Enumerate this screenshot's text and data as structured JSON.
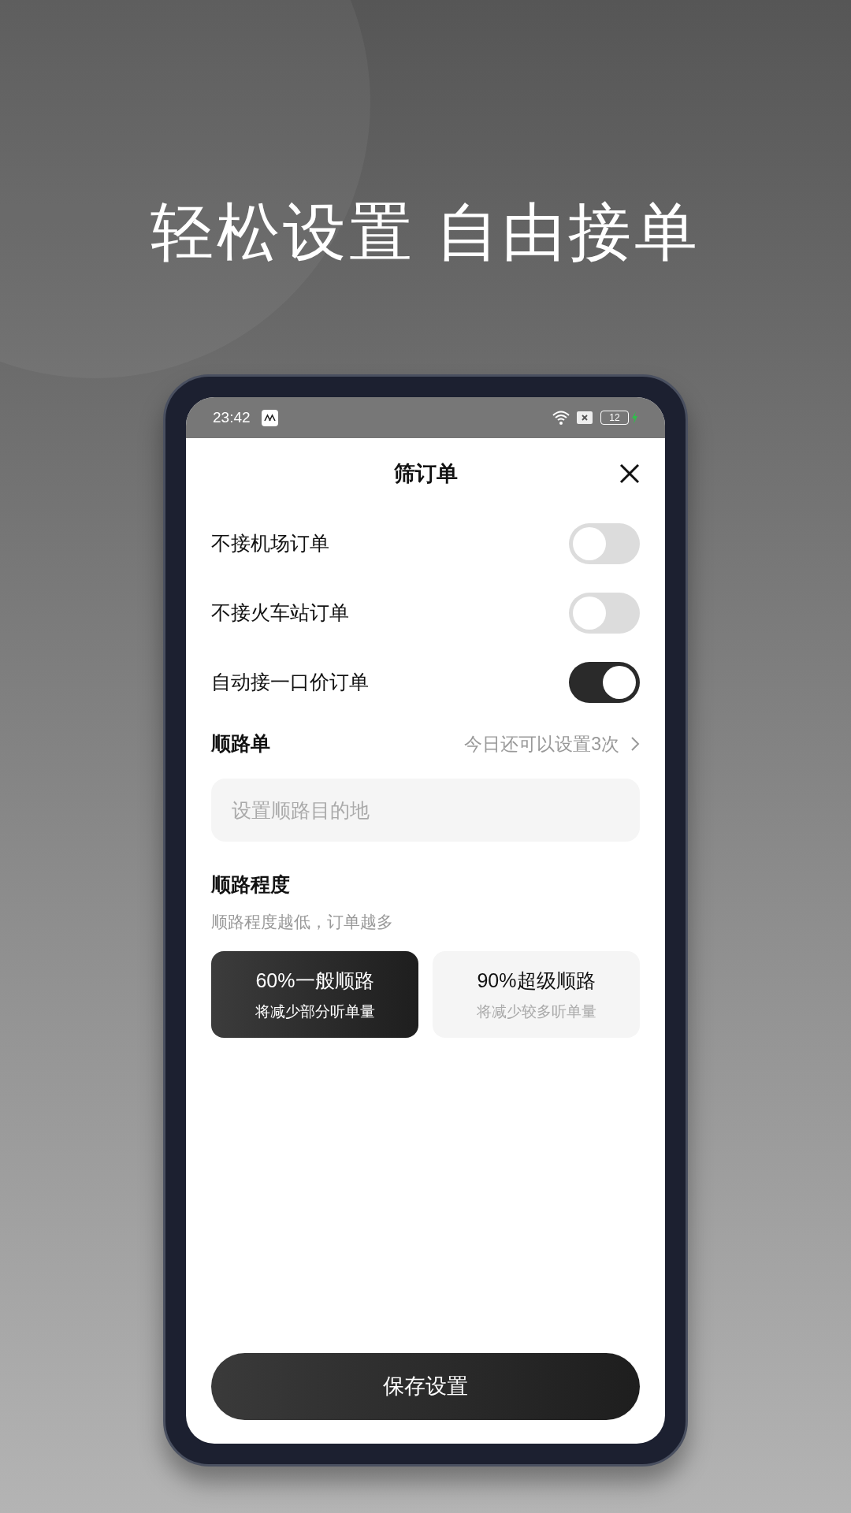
{
  "headline": "轻松设置 自由接单",
  "status_bar": {
    "time": "23:42",
    "battery": "12"
  },
  "sheet": {
    "title": "筛订单"
  },
  "toggles": [
    {
      "label": "不接机场订单",
      "on": false
    },
    {
      "label": "不接火车站订单",
      "on": false
    },
    {
      "label": "自动接一口价订单",
      "on": true
    }
  ],
  "route": {
    "label": "顺路单",
    "hint": "今日还可以设置3次",
    "placeholder": "设置顺路目的地"
  },
  "degree": {
    "title": "顺路程度",
    "subtitle": "顺路程度越低，订单越多",
    "options": [
      {
        "title": "60%一般顺路",
        "note": "将减少部分听单量",
        "selected": true
      },
      {
        "title": "90%超级顺路",
        "note": "将减少较多听单量",
        "selected": false
      }
    ]
  },
  "save_button": "保存设置"
}
